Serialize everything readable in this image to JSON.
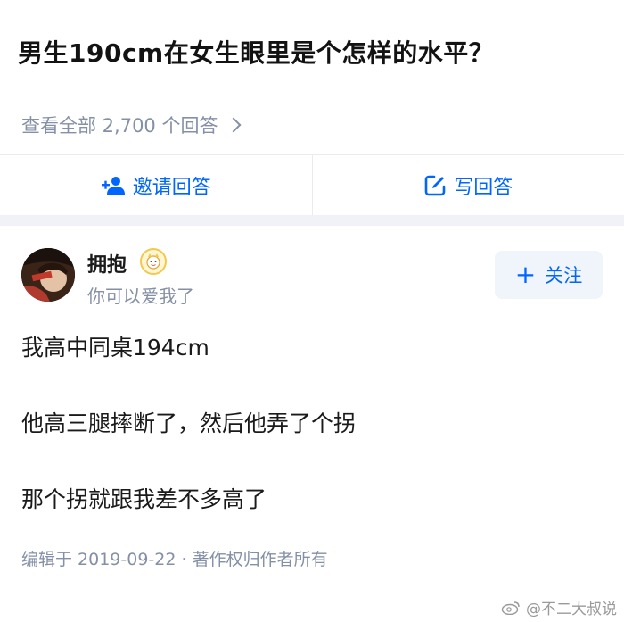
{
  "question": {
    "title": "男生190cm在女生眼里是个怎样的水平？"
  },
  "view_all": {
    "label": "查看全部 2,700 个回答"
  },
  "actions": {
    "invite_label": "邀请回答",
    "write_label": "写回答"
  },
  "author": {
    "name": "拥抱",
    "bio": "你可以爱我了",
    "follow_label": "关注"
  },
  "answer": {
    "paragraphs": [
      "我高中同桌194cm",
      "他高三腿摔断了，然后他弄了个拐",
      "那个拐就跟我差不多高了"
    ],
    "meta": "编辑于 2019-09-22 · 著作权归作者所有"
  },
  "watermark": {
    "text": "@不二大叔说"
  },
  "colors": {
    "accent": "#0066ff",
    "muted": "#8590a6",
    "band": "#f0f2f7"
  }
}
